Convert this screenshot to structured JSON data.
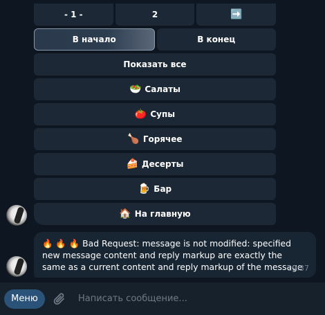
{
  "keyboard": {
    "pagination": {
      "prev": "- 1 -",
      "current": "2",
      "next_icon": "➡️"
    },
    "nav": {
      "start": "В начало",
      "end": "В конец"
    },
    "show_all": "Показать все",
    "categories": [
      {
        "emoji": "🥗",
        "label": "Салаты"
      },
      {
        "emoji": "🍅",
        "label": "Супы"
      },
      {
        "emoji": "🍗",
        "label": "Горячее"
      },
      {
        "emoji": "🍰",
        "label": "Десерты"
      },
      {
        "emoji": "🍺",
        "label": "Бар"
      },
      {
        "emoji": "🏠",
        "label": "На главную"
      }
    ]
  },
  "message": {
    "emojis": "🔥 🔥 🔥",
    "text": "Bad Request: message is not modified: specified new message content and reply markup are exactly the same as a current content and reply markup of the message",
    "time": "19:37"
  },
  "composer": {
    "menu_label": "Меню",
    "placeholder": "Написать сообщение..."
  },
  "colors": {
    "background": "#0e1621",
    "button": "#1d2836",
    "bubble": "#182533",
    "menu_button": "#2b5278",
    "composer": "#17212b"
  }
}
